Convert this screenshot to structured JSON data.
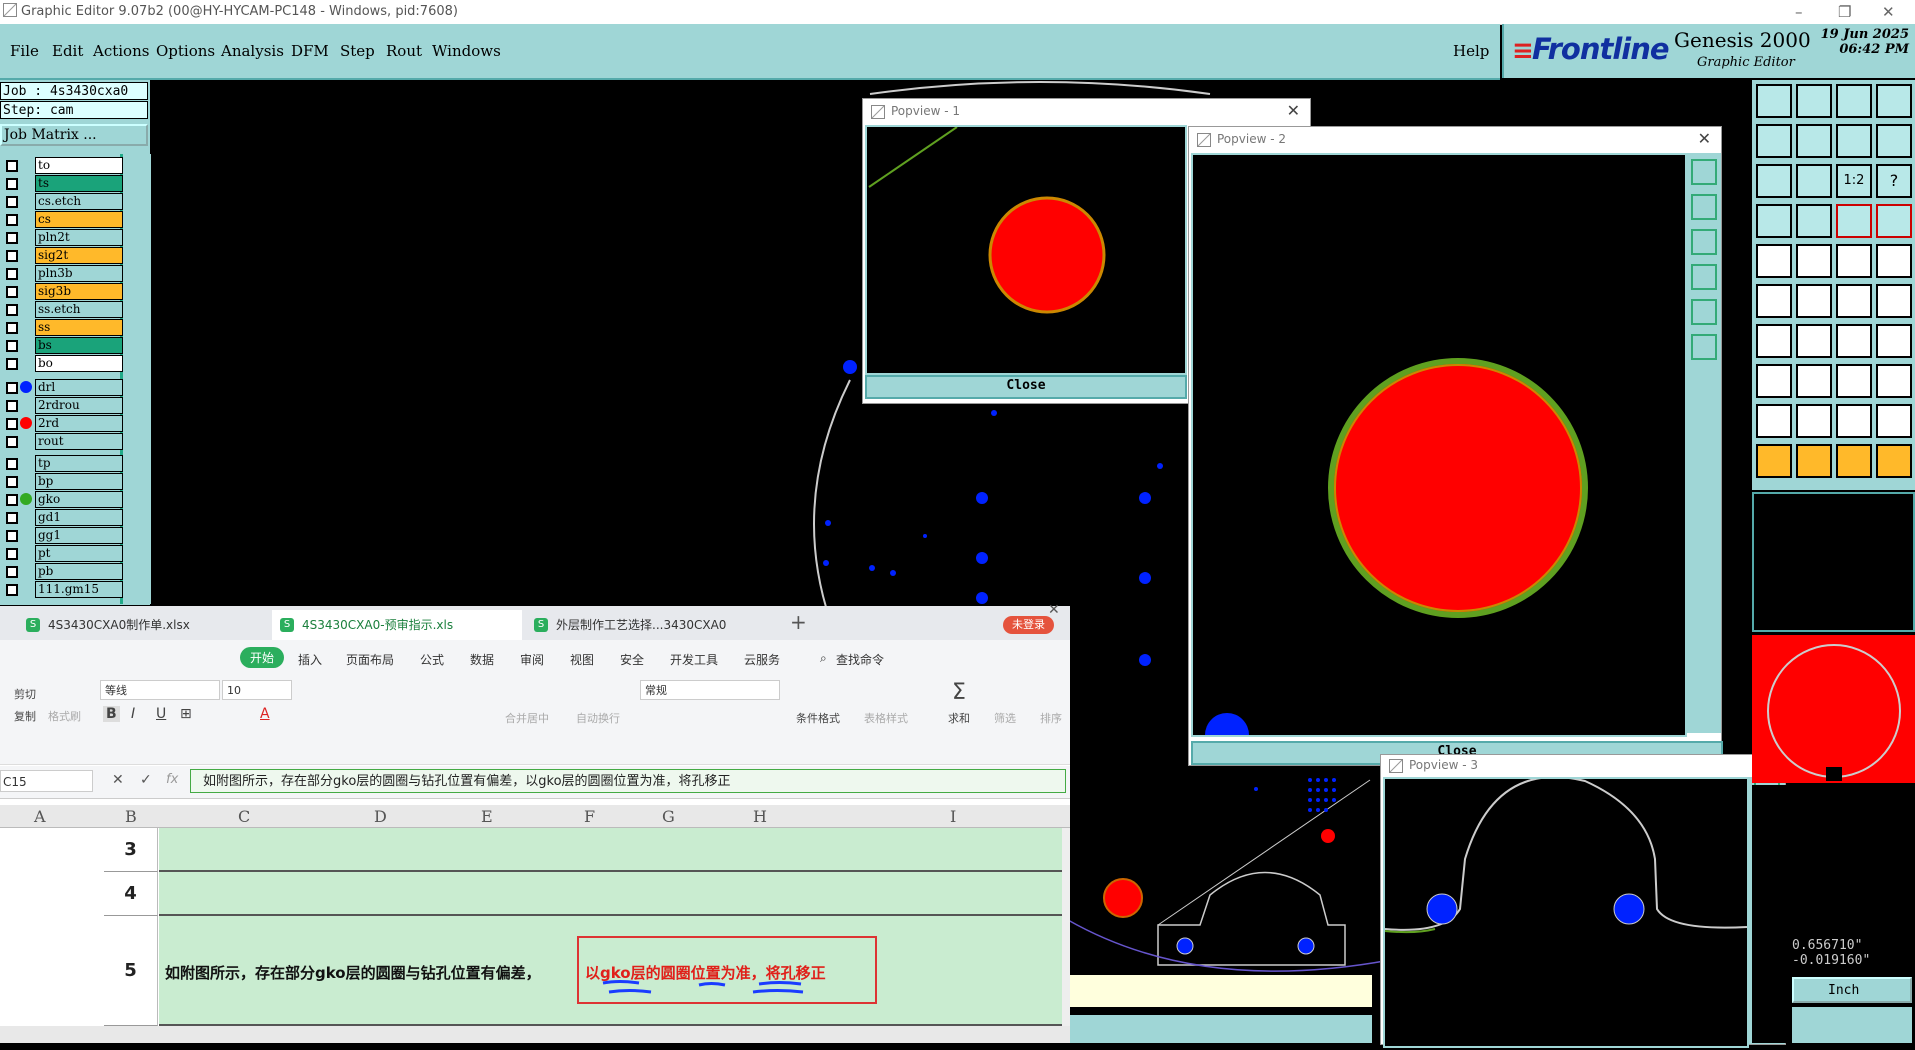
{
  "window": {
    "title": "Graphic Editor 9.07b2 (00@HY-HYCAM-PC148 - Windows, pid:7608)"
  },
  "menu": [
    "File",
    "Edit",
    "Actions",
    "Options",
    "Analysis",
    "DFM",
    "Step",
    "Rout",
    "Windows"
  ],
  "help_label": "Help",
  "brand": {
    "logo": "Frontline",
    "product": "Genesis 2000",
    "subtitle": "Graphic Editor",
    "date": "19 Jun 2025",
    "time": "06:42 PM"
  },
  "job": {
    "job_label": "Job : 4s3430cxa0",
    "step_label": "Step: cam",
    "matrix_button": "Job Matrix ..."
  },
  "layers": [
    {
      "name": "to",
      "color": "#ffffff",
      "dot": ""
    },
    {
      "name": "ts",
      "color": "#1aa37a",
      "dot": ""
    },
    {
      "name": "cs.etch",
      "color": "#9fd6d6",
      "dot": ""
    },
    {
      "name": "cs",
      "color": "#ffb92a",
      "dot": ""
    },
    {
      "name": "pln2t",
      "color": "#9fd6d6",
      "dot": ""
    },
    {
      "name": "sig2t",
      "color": "#ffb92a",
      "dot": ""
    },
    {
      "name": "pln3b",
      "color": "#9fd6d6",
      "dot": ""
    },
    {
      "name": "sig3b",
      "color": "#ffb92a",
      "dot": ""
    },
    {
      "name": "ss.etch",
      "color": "#9fd6d6",
      "dot": ""
    },
    {
      "name": "ss",
      "color": "#ffb92a",
      "dot": ""
    },
    {
      "name": "bs",
      "color": "#1aa37a",
      "dot": ""
    },
    {
      "name": "bo",
      "color": "#ffffff",
      "dot": ""
    },
    {
      "name": "drl",
      "color": "#9fd6d6",
      "dot": "#0022ff"
    },
    {
      "name": "2rdrou",
      "color": "#9fd6d6",
      "dot": ""
    },
    {
      "name": "2rd",
      "color": "#9fd6d6",
      "dot": "#ff0000"
    },
    {
      "name": "rout",
      "color": "#9fd6d6",
      "dot": ""
    },
    {
      "name": "tp",
      "color": "#9fd6d6",
      "dot": ""
    },
    {
      "name": "bp",
      "color": "#9fd6d6",
      "dot": ""
    },
    {
      "name": "gko",
      "color": "#9fd6d6",
      "dot": "#33aa22"
    },
    {
      "name": "gd1",
      "color": "#9fd6d6",
      "dot": ""
    },
    {
      "name": "gg1",
      "color": "#9fd6d6",
      "dot": ""
    },
    {
      "name": "pt",
      "color": "#9fd6d6",
      "dot": ""
    },
    {
      "name": "pb",
      "color": "#9fd6d6",
      "dot": ""
    },
    {
      "name": "111.gm15",
      "color": "#9fd6d6",
      "dot": ""
    }
  ],
  "popviews": {
    "p1_title": "Popview - 1",
    "p2_title": "Popview - 2",
    "p3_title": "Popview - 3",
    "close_label": "Close"
  },
  "coords": {
    "x": "0.656710\"",
    "y": "-0.019160\"",
    "units": "Inch"
  },
  "spreadsheet": {
    "tabs": [
      {
        "label": "4S3430CXA0制作单.xlsx"
      },
      {
        "label": "4S3430CXA0-预审指示.xls"
      },
      {
        "label": "外层制作工艺选择...3430CXA0"
      }
    ],
    "login_badge": "未登录",
    "ribbon": [
      "开始",
      "插入",
      "页面布局",
      "公式",
      "数据",
      "审阅",
      "视图",
      "安全",
      "开发工具",
      "云服务"
    ],
    "search_label": "查找命令",
    "tools": {
      "cut": "剪切",
      "copy": "复制",
      "format_painter": "格式刷",
      "font_name": "等线",
      "font_size": "10",
      "merge_center": "合并居中",
      "wrap": "自动换行",
      "number_format": "常规",
      "cond_format": "条件格式",
      "table_style": "表格样式",
      "sum": "求和",
      "filter": "筛选",
      "sort": "排序",
      "bold": "B",
      "italic": "I",
      "underline": "U"
    },
    "cell_ref": "C15",
    "fx": "fx",
    "formula_text": "如附图所示，存在部分gko层的圆圈与钻孔位置有偏差，以gko层的圆圈位置为准，将孔移正",
    "columns": [
      "A",
      "B",
      "C",
      "D",
      "E",
      "F",
      "G",
      "H",
      "I"
    ],
    "rows": [
      {
        "num": "3",
        "text_black": "",
        "text_red": ""
      },
      {
        "num": "4",
        "text_black": "",
        "text_red": ""
      },
      {
        "num": "5",
        "text_black": "如附图所示，存在部分gko层的圆圈与钻孔位置有偏差，",
        "text_red": "以gko层的圆圈位置为准，将孔移正"
      }
    ]
  },
  "colors": {
    "panel": "#9fd6d6",
    "gold": "#ffb92a",
    "pad_red": "#ff0000",
    "drill_blue": "#0022ff",
    "outline_green": "#5fa020",
    "sheet_green": "#c9ecd0"
  }
}
